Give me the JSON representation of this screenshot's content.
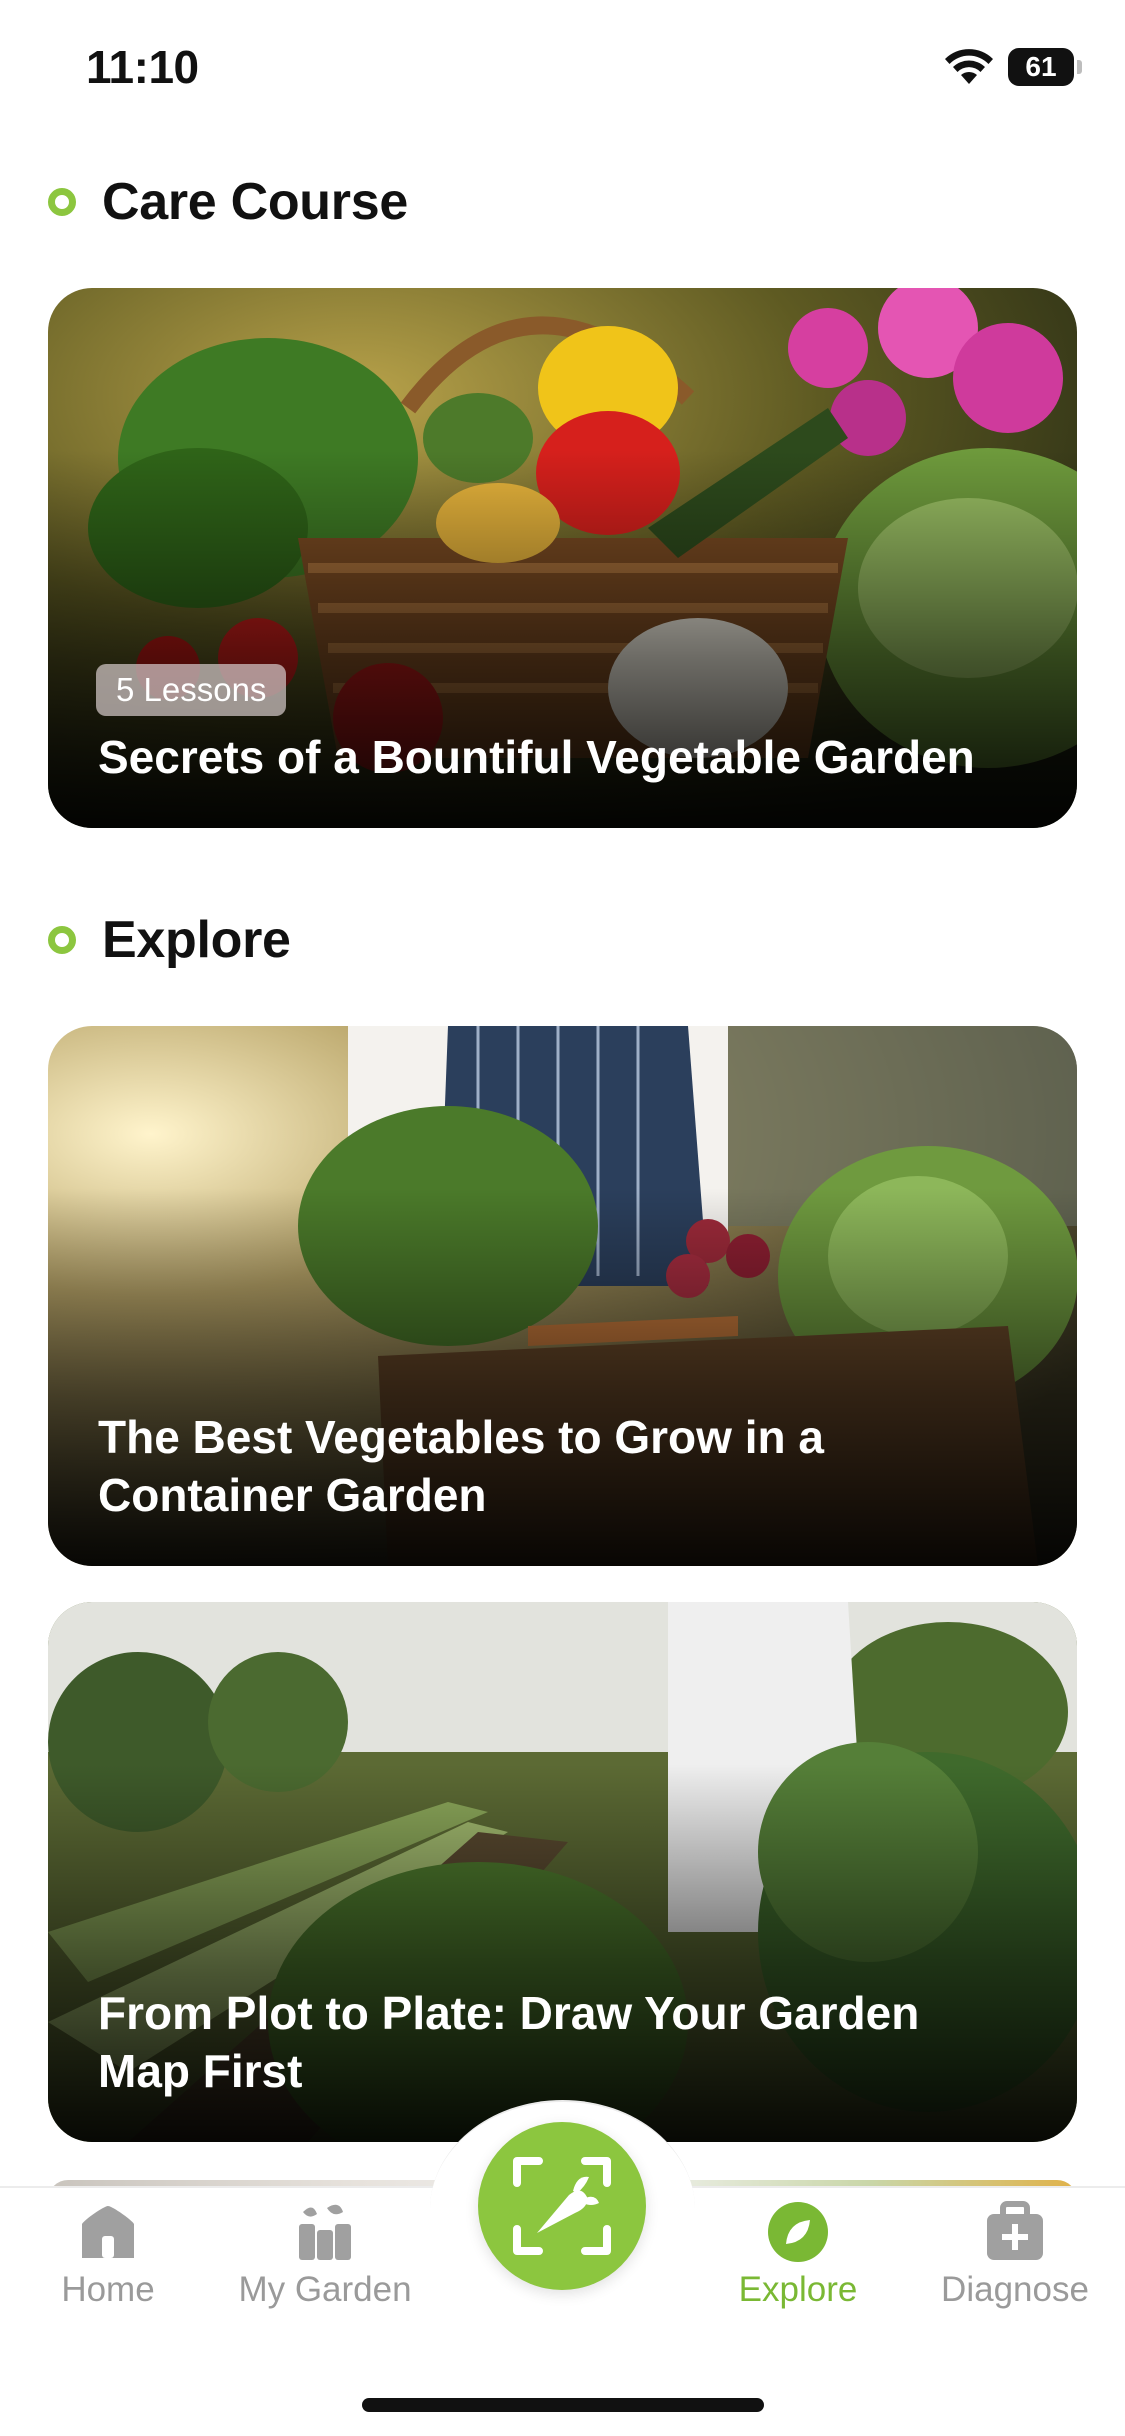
{
  "status_bar": {
    "time": "11:10",
    "battery": "61"
  },
  "care_course": {
    "section_title": "Care Course",
    "card": {
      "badge": "5 Lessons",
      "title": "Secrets of a Bountiful Vegetable Garden"
    }
  },
  "explore": {
    "section_title": "Explore",
    "cards": [
      {
        "title": "The Best Vegetables to Grow in a Container Garden"
      },
      {
        "title": "From Plot to Plate: Draw Your Garden Map First"
      }
    ]
  },
  "tab_bar": {
    "items": [
      {
        "label": "Home",
        "icon": "home-icon",
        "active": false
      },
      {
        "label": "My Garden",
        "icon": "my-garden-icon",
        "active": false
      },
      {
        "label": "Explore",
        "icon": "explore-leaf-icon",
        "active": true
      },
      {
        "label": "Diagnose",
        "icon": "diagnose-kit-icon",
        "active": false
      }
    ],
    "center_button_icon": "scan-plant-icon"
  },
  "colors": {
    "accent": "#8cc63f",
    "accent_text": "#7ab834",
    "inactive": "#9a9a9a"
  }
}
